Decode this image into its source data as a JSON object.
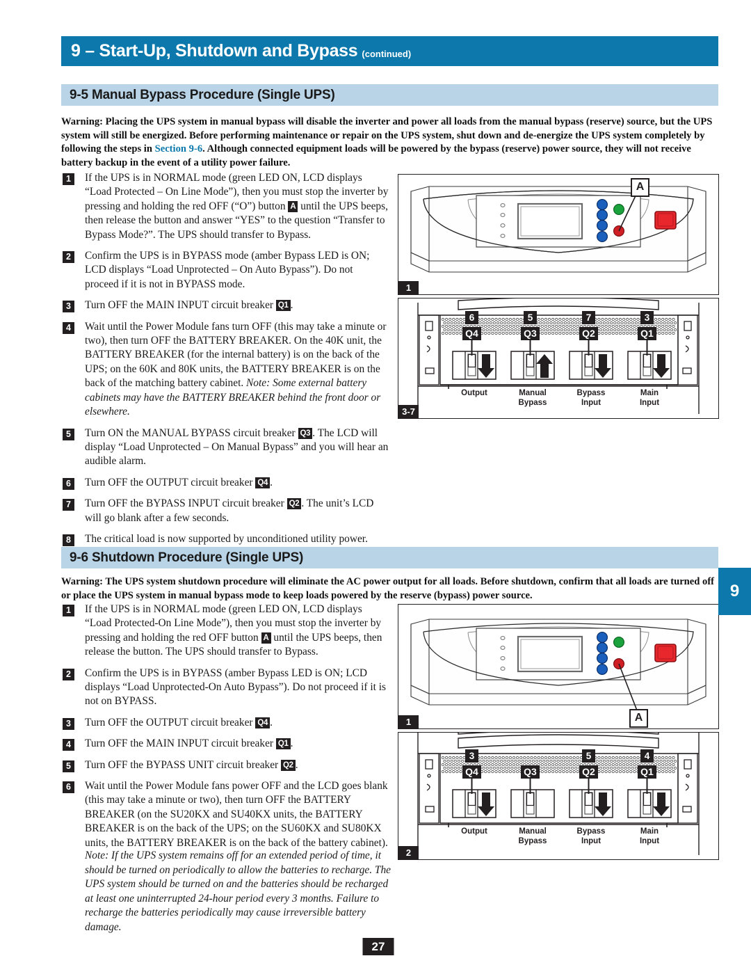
{
  "header": {
    "chapter_title": "9 – Start-Up, Shutdown and Bypass",
    "continued": "(continued)",
    "accent_color": "#0c78ac",
    "band_color": "#b9d4e6"
  },
  "section_95": {
    "band_label": "9-5 Manual Bypass Procedure (Single UPS)",
    "warning_parts": {
      "p1": "Warning: Placing the UPS system in manual bypass will disable the inverter and power all loads from the manual bypass (reserve) source, but the UPS system will still be energized. Before performing maintenance or repair on the UPS system, shut down and de-energize the UPS system completely by following the steps in ",
      "link": "Section 9-6",
      "p2": ". Although connected equipment loads will be powered by the bypass (reserve) power source, they will not receive battery backup in the event of a utility power failure."
    },
    "steps": [
      {
        "num": "1",
        "a": "If the UPS is in NORMAL mode (green LED ON, LCD displays “Load Protected – On Line Mode”), then you must stop the inverter by pressing and holding the red OFF (“O”) button ",
        "chip": "A",
        "b": " until the UPS beeps, then release the button and answer “YES” to the question “Transfer to Bypass Mode?”. The UPS should transfer to Bypass."
      },
      {
        "num": "2",
        "a": "Confirm the UPS is in BYPASS mode (amber Bypass LED is ON; LCD displays “Load Unprotected – On Auto Bypass”). Do not proceed if it is not in BYPASS mode.",
        "chip": "",
        "b": ""
      },
      {
        "num": "3",
        "a": "Turn OFF the MAIN INPUT circuit breaker ",
        "chip": "Q1",
        "b": "."
      },
      {
        "num": "4",
        "a": "Wait until the Power Module fans turn OFF (this may take a minute or two), then turn OFF the BATTERY BREAKER. On the 40K unit, the BATTERY BREAKER (for the internal battery) is on the back of the UPS; on the 60K and 80K units, the BATTERY BREAKER is on the back of the matching battery cabinet. ",
        "chip": "",
        "b": "",
        "italic_tail": "Note: Some external battery cabinets may have the BATTERY BREAKER behind the front door or elsewhere."
      },
      {
        "num": "5",
        "a": "Turn ON the MANUAL BYPASS circuit breaker ",
        "chip": "Q3",
        "b": ". The LCD will display “Load Unprotected – On Manual Bypass” and you will hear an audible alarm."
      },
      {
        "num": "6",
        "a": "Turn OFF the OUTPUT circuit breaker ",
        "chip": "Q4",
        "b": "."
      },
      {
        "num": "7",
        "a": "Turn OFF the BYPASS INPUT circuit breaker ",
        "chip": "Q2",
        "b": ". The unit’s LCD will go blank after a few seconds."
      },
      {
        "num": "8",
        "a": "The critical load is now supported by unconditioned utility power.",
        "chip": "",
        "b": ""
      }
    ]
  },
  "section_96": {
    "band_label": "9-6 Shutdown Procedure (Single UPS)",
    "warning": "Warning: The UPS system shutdown procedure will eliminate the AC power output for all loads. Before shutdown, confirm that all loads are turned off or place the UPS system in manual bypass mode to keep loads powered by the reserve (bypass) power source.",
    "steps": [
      {
        "num": "1",
        "a": "If the UPS is in NORMAL mode (green LED ON, LCD displays “Load Protected-On Line Mode”), then you must stop the inverter by pressing and holding the red OFF button ",
        "chip": "A",
        "b": " until the UPS beeps, then release the button. The UPS should transfer to Bypass."
      },
      {
        "num": "2",
        "a": "Confirm the UPS is in BYPASS (amber Bypass LED is ON; LCD displays “Load Unprotected-On Auto Bypass”). Do not proceed if it is not on BYPASS.",
        "chip": "",
        "b": ""
      },
      {
        "num": "3",
        "a": "Turn OFF the OUTPUT circuit breaker ",
        "chip": "Q4",
        "b": "."
      },
      {
        "num": "4",
        "a": "Turn OFF the MAIN INPUT circuit breaker ",
        "chip": "Q1",
        "b": "."
      },
      {
        "num": "5",
        "a": "Turn OFF the BYPASS UNIT circuit breaker ",
        "chip": "Q2",
        "b": "."
      },
      {
        "num": "6",
        "a": "Wait until the Power Module fans power OFF and the LCD goes blank (this may take a minute or two), then turn OFF the BATTERY BREAKER (on the SU20KX and SU40KX units, the BATTERY BREAKER is on the back of the UPS; on the SU60KX and SU80KX units, the BATTERY BREAKER is on the back of the battery cabinet).",
        "chip": "",
        "b": ""
      }
    ],
    "note": "Note: If the UPS system remains off for an extended period of time, it should be turned on periodically to allow the batteries to recharge. The UPS system should be turned on and the batteries should be recharged at least one uninterrupted 24-hour period every 3 months. Failure to recharge the batteries periodically may cause irreversible battery damage."
  },
  "figures": {
    "fig1": {
      "tag": "1",
      "callout": "A",
      "caption_desc": "ups-front-panel"
    },
    "fig2": {
      "tag": "3-7",
      "breakers": [
        {
          "badge": "6",
          "q": "Q4",
          "label": "Output",
          "arrow": "down"
        },
        {
          "badge": "5",
          "q": "Q3",
          "label": "Manual\nBypass",
          "arrow": "up"
        },
        {
          "badge": "7",
          "q": "Q2",
          "label": "Bypass\nInput",
          "arrow": "down"
        },
        {
          "badge": "3",
          "q": "Q1",
          "label": "Main\nInput",
          "arrow": "down"
        }
      ],
      "labels": [
        "Output",
        "Manual Bypass",
        "Bypass Input",
        "Main Input"
      ]
    },
    "fig3": {
      "tag": "1",
      "callout": "A",
      "caption_desc": "ups-front-panel"
    },
    "fig4": {
      "tag": "2",
      "breakers": [
        {
          "badge": "3",
          "q": "Q4",
          "label": "Output",
          "arrow": "down"
        },
        {
          "badge": "",
          "q": "Q3",
          "label": "Manual\nBypass",
          "arrow": "none"
        },
        {
          "badge": "5",
          "q": "Q2",
          "label": "Bypass\nInput",
          "arrow": "down"
        },
        {
          "badge": "4",
          "q": "Q1",
          "label": "Main\nInput",
          "arrow": "down"
        }
      ],
      "labels": [
        "Output",
        "Manual Bypass",
        "Bypass Input",
        "Main Input"
      ]
    },
    "led_colors": {
      "blue": "#1b5fbd",
      "green": "#1aa33c",
      "red": "#cf1f24",
      "button_red": "#e8272d"
    }
  },
  "side_tab": {
    "number": "9"
  },
  "footer": {
    "page_number": "27"
  }
}
